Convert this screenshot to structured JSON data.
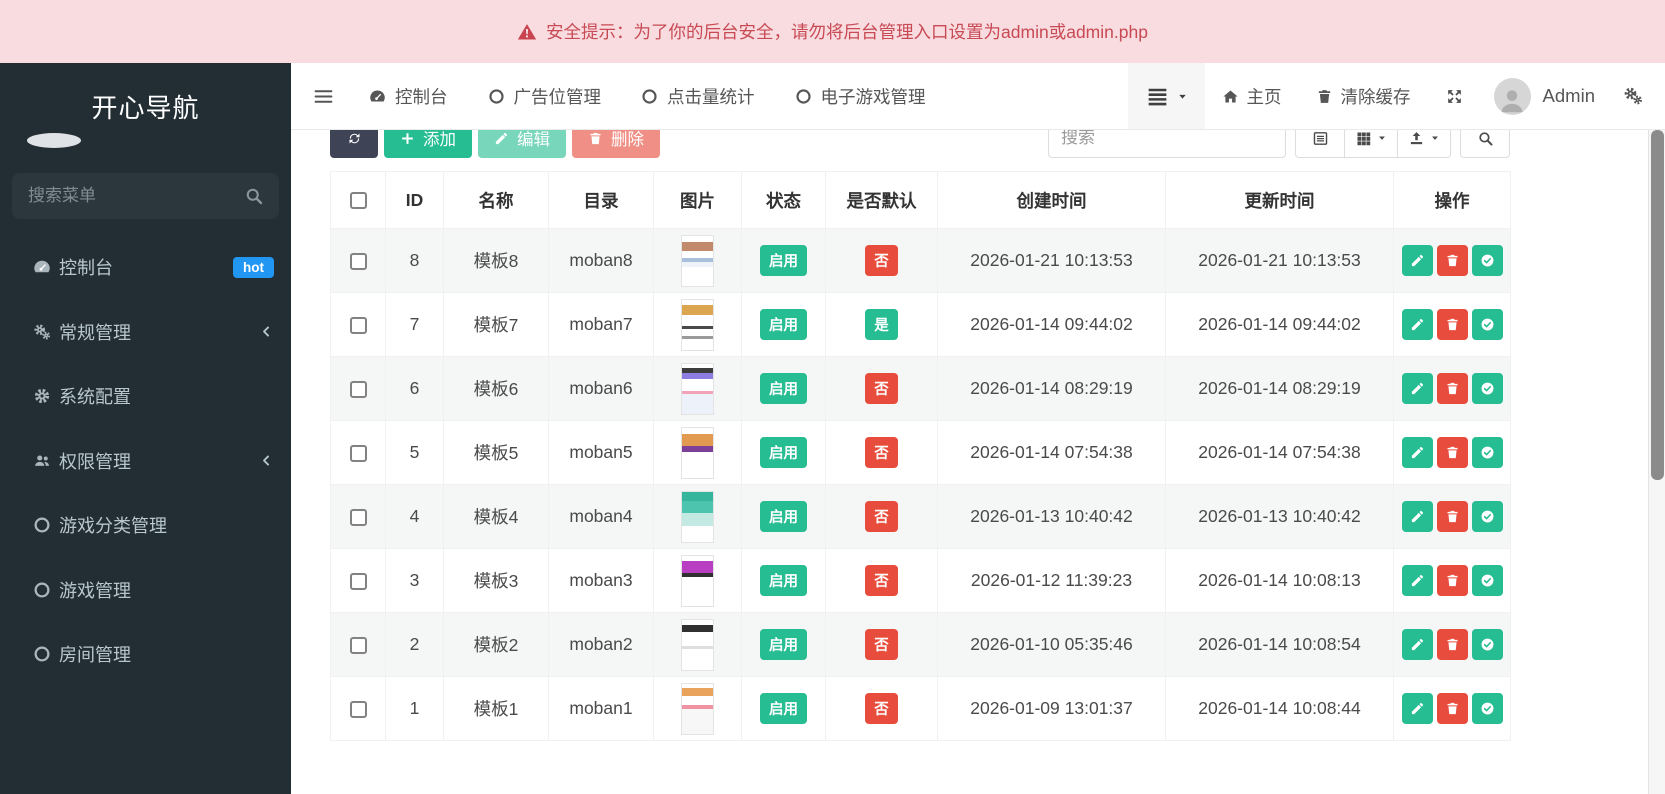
{
  "banner": {
    "text": "安全提示：为了你的后台安全，请勿将后台管理入口设置为admin或admin.php"
  },
  "sidebar": {
    "title": "开心导航",
    "search_placeholder": "搜索菜单",
    "items": [
      {
        "label": "控制台",
        "icon": "dashboard-icon",
        "badge": "hot",
        "chevron": false
      },
      {
        "label": "常规管理",
        "icon": "cogs-icon",
        "badge": "",
        "chevron": true
      },
      {
        "label": "系统配置",
        "icon": "gear-icon",
        "badge": "",
        "chevron": false
      },
      {
        "label": "权限管理",
        "icon": "users-icon",
        "badge": "",
        "chevron": true
      },
      {
        "label": "游戏分类管理",
        "icon": "circle-icon",
        "badge": "",
        "chevron": false
      },
      {
        "label": "游戏管理",
        "icon": "circle-icon",
        "badge": "",
        "chevron": false
      },
      {
        "label": "房间管理",
        "icon": "circle-icon",
        "badge": "",
        "chevron": false
      }
    ]
  },
  "navbar": {
    "tabs": [
      {
        "label": "控制台",
        "icon": "dashboard-icon"
      },
      {
        "label": "广告位管理",
        "icon": "circle-icon"
      },
      {
        "label": "点击量统计",
        "icon": "circle-icon"
      },
      {
        "label": "电子游戏管理",
        "icon": "circle-icon"
      }
    ],
    "home_label": "主页",
    "clear_cache_label": "清除缓存",
    "username": "Admin"
  },
  "toolbar": {
    "add_label": "添加",
    "edit_label": "编辑",
    "delete_label": "删除",
    "search_placeholder": "搜索"
  },
  "table": {
    "columns": [
      "ID",
      "名称",
      "目录",
      "图片",
      "状态",
      "是否默认",
      "创建时间",
      "更新时间",
      "操作"
    ],
    "rows": [
      {
        "id": "8",
        "name": "模板8",
        "dir": "moban8",
        "status": "启用",
        "is_default": "否",
        "created": "2026-01-21 10:13:53",
        "updated": "2026-01-21 10:13:53",
        "thumb": "linear-gradient(180deg,#ffffff 0%,#ffffff 12%,#c18a6c 12%,#c18a6c 30%,#ffffff 30%,#ffffff 44%,#a9c0dc 44%,#a9c0dc 52%,#eef3fa 52%,#eef3fa 62%,#ffffff 62%,#ffffff 100%)"
      },
      {
        "id": "7",
        "name": "模板7",
        "dir": "moban7",
        "status": "启用",
        "is_default": "是",
        "created": "2026-01-14 09:44:02",
        "updated": "2026-01-14 09:44:02",
        "thumb": "linear-gradient(180deg,#ffffff 0%,#ffffff 10%,#dca54f 10%,#dca54f 30%,#ffffff 30%,#ffffff 52%,#4a4a4a 52%,#4a4a4a 58%,#ffffff 58%,#ffffff 72%,#9a9a9a 72%,#9a9a9a 78%,#ffffff 78%,#ffffff 100%)"
      },
      {
        "id": "6",
        "name": "模板6",
        "dir": "moban6",
        "status": "启用",
        "is_default": "否",
        "created": "2026-01-14 08:29:19",
        "updated": "2026-01-14 08:29:19",
        "thumb": "linear-gradient(180deg,#ffffff 0%,#ffffff 8%,#3c3c3c 8%,#3c3c3c 18%,#8d7de0 18%,#8d7de0 30%,#ffffff 30%,#ffffff 54%,#f2a3b8 54%,#f2a3b8 60%,#edf1fa 60%,#edf1fa 100%)"
      },
      {
        "id": "5",
        "name": "模板5",
        "dir": "moban5",
        "status": "启用",
        "is_default": "否",
        "created": "2026-01-14 07:54:38",
        "updated": "2026-01-14 07:54:38",
        "thumb": "linear-gradient(180deg,#ffffff 0%,#ffffff 12%,#e29a50 12%,#e29a50 36%,#7e3f99 36%,#7e3f99 48%,#ffffff 48%,#ffffff 100%)"
      },
      {
        "id": "4",
        "name": "模板4",
        "dir": "moban4",
        "status": "启用",
        "is_default": "否",
        "created": "2026-01-13 10:40:42",
        "updated": "2026-01-13 10:40:42",
        "thumb": "linear-gradient(180deg,#35b59b 0%,#35b59b 18%,#4cc4ae 18%,#4cc4ae 42%,#c2e9e2 42%,#c2e9e2 68%,#ffffff 68%,#ffffff 100%)"
      },
      {
        "id": "3",
        "name": "模板3",
        "dir": "moban3",
        "status": "启用",
        "is_default": "否",
        "created": "2026-01-12 11:39:23",
        "updated": "2026-01-14 10:08:13",
        "thumb": "linear-gradient(180deg,#ffffff 0%,#ffffff 10%,#b83fc1 10%,#b83fc1 34%,#303030 34%,#303030 42%,#ffffff 42%,#ffffff 100%)"
      },
      {
        "id": "2",
        "name": "模板2",
        "dir": "moban2",
        "status": "启用",
        "is_default": "否",
        "created": "2026-01-10 05:35:46",
        "updated": "2026-01-14 10:08:54",
        "thumb": "linear-gradient(180deg,#ffffff 0%,#ffffff 10%,#303030 10%,#303030 24%,#ffffff 24%,#ffffff 52%,#dedede 52%,#dedede 58%,#ffffff 58%,#ffffff 100%)"
      },
      {
        "id": "1",
        "name": "模板1",
        "dir": "moban1",
        "status": "启用",
        "is_default": "否",
        "created": "2026-01-09 13:01:37",
        "updated": "2026-01-14 10:08:44",
        "thumb": "linear-gradient(180deg,#ffffff 0%,#ffffff 8%,#eaa35c 8%,#eaa35c 24%,#ffffff 24%,#ffffff 42%,#ef92a2 42%,#ef92a2 50%,#f7f7f7 50%,#f7f7f7 100%)"
      }
    ]
  },
  "colors": {
    "green": "#26bd92",
    "red": "#e74c3c",
    "dark_button": "#3e4456",
    "hot_badge": "#2196f3",
    "banner_bg": "#f8dce0",
    "banner_text": "#c84a54",
    "sidebar_bg": "#232e34"
  }
}
